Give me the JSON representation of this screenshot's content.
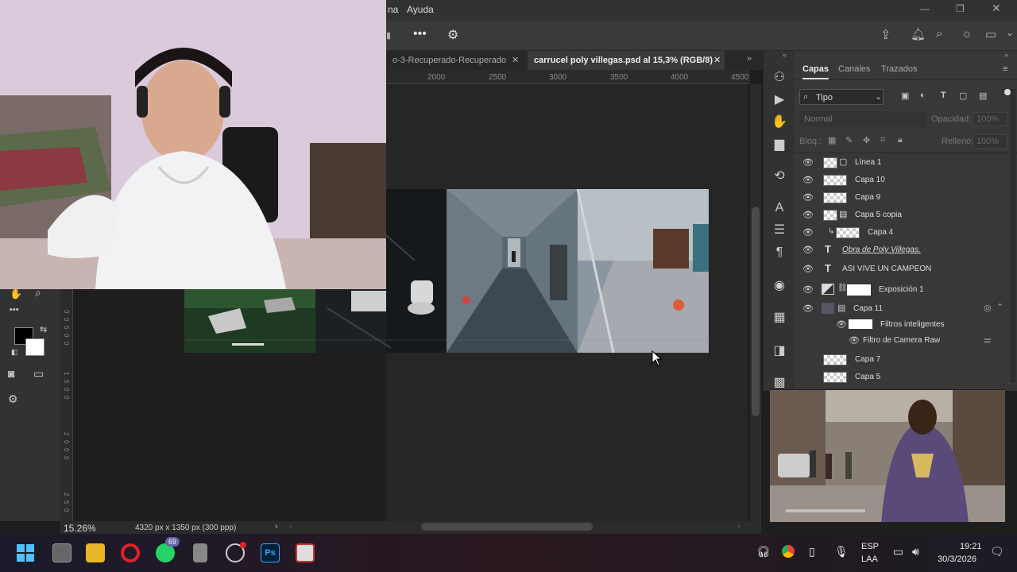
{
  "menu": {
    "partial_item": "na",
    "help": "Ayuda"
  },
  "tabs": {
    "inactive": "o-3-Recuperado-Recuperado",
    "active": "carrucel poly villegas.psd al 15,3% (RGB/8)"
  },
  "ruler_top": [
    "2000",
    "2500",
    "3000",
    "3500",
    "4000",
    "4500"
  ],
  "ruler_left": [
    "0",
    "0",
    "5",
    "0",
    "0",
    "1",
    "5",
    "0",
    "0",
    "2",
    "0",
    "0",
    "0",
    "2",
    "5",
    "0"
  ],
  "status": {
    "zoom": "15.26%",
    "doc_info": "4320 px x 1350 px (300 ppp)"
  },
  "panel": {
    "tabs": [
      "Capas",
      "Canales",
      "Trazados"
    ],
    "filter": "Tipo",
    "blend_mode": "Normal",
    "opacity_label": "Opacidad:",
    "opacity_value": "100%",
    "lock_label": "Bloq.:",
    "fill_label": "Relleno:",
    "fill_value": "100%",
    "layers": [
      {
        "name": "Línea 1"
      },
      {
        "name": "Capa 10"
      },
      {
        "name": "Capa 9"
      },
      {
        "name": "Capa 5 copia"
      },
      {
        "name": "Capa 4"
      },
      {
        "name": "Obra de Poly Villegas."
      },
      {
        "name": "ASI VIVE UN CAMPEON"
      },
      {
        "name": "Exposición 1"
      },
      {
        "name": "Capa 11"
      },
      {
        "name": "Filtros inteligentes"
      },
      {
        "name": "Filtro de Camera Raw"
      },
      {
        "name": "Capa 7"
      },
      {
        "name": "Capa 5"
      }
    ]
  },
  "taskbar": {
    "whatsapp_badge": "69",
    "lang": "ESP",
    "lang2": "LAA",
    "time": "19:21",
    "date": "30/3/2026"
  },
  "icons": {
    "start": "windows-start-icon",
    "search": "search-icon",
    "gear": "gear-icon",
    "bell": "bell-icon",
    "share": "share-icon"
  },
  "colors": {
    "accent": "#31a8ff",
    "panel_bg": "#383838",
    "canvas_bg": "#1e1e1e"
  }
}
